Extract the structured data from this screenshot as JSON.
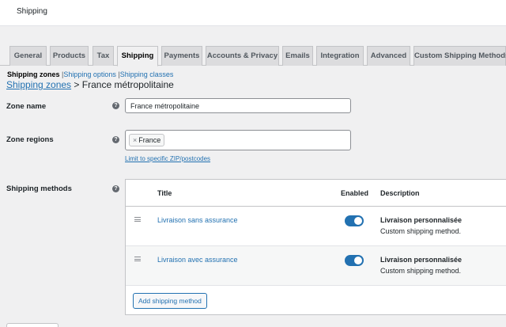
{
  "header": {
    "title": "Shipping"
  },
  "tabs": [
    {
      "label": "General"
    },
    {
      "label": "Products"
    },
    {
      "label": "Tax"
    },
    {
      "label": "Shipping"
    },
    {
      "label": "Payments"
    },
    {
      "label": "Accounts & Privacy"
    },
    {
      "label": "Emails"
    },
    {
      "label": "Integration"
    },
    {
      "label": "Advanced"
    },
    {
      "label": "Custom Shipping Methods"
    }
  ],
  "subnav": {
    "current": "Shipping zones",
    "options": "Shipping options",
    "classes": "Shipping classes",
    "separator": "|"
  },
  "breadcrumb": {
    "link": "Shipping zones",
    "separator": ">",
    "current": "France métropolitaine"
  },
  "form": {
    "zone_name_label": "Zone name",
    "zone_name_value": "France métropolitaine",
    "zone_regions_label": "Zone regions",
    "region_chip": "France",
    "region_remove": "×",
    "limit_link": "Limit to specific ZIP/postcodes",
    "shipping_methods_label": "Shipping methods",
    "help_glyph": "?"
  },
  "methods": {
    "headers": {
      "title": "Title",
      "enabled": "Enabled",
      "description": "Description"
    },
    "rows": [
      {
        "title": "Livraison sans assurance",
        "enabled": true,
        "desc_title": "Livraison personnalisée",
        "desc_text": "Custom shipping method."
      },
      {
        "title": "Livraison avec assurance",
        "enabled": true,
        "desc_title": "Livraison personnalisée",
        "desc_text": "Custom shipping method."
      }
    ],
    "add_button": "Add shipping method"
  },
  "colors": {
    "accent": "#2271b1",
    "background": "#f0f0f1"
  }
}
